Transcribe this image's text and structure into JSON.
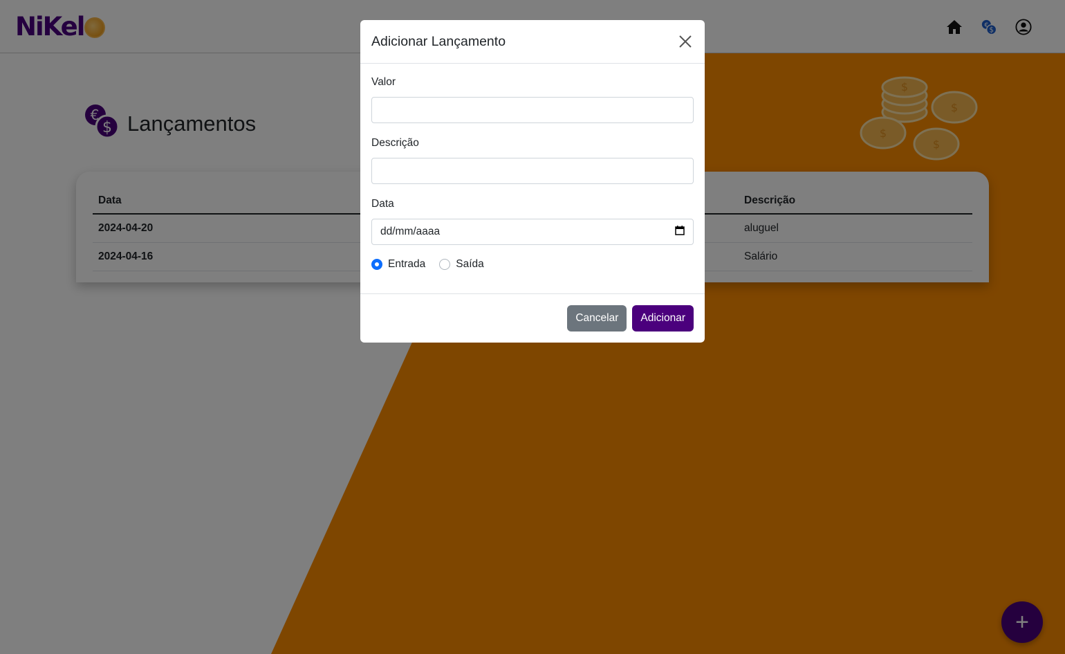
{
  "navbar": {
    "logo_text": "NiKel",
    "icons": [
      "home-icon",
      "currency-icon",
      "user-icon"
    ]
  },
  "page": {
    "title": "Lançamentos",
    "icon": "currency-icon"
  },
  "table": {
    "headers": {
      "date": "Data",
      "description": "Descrição"
    },
    "rows": [
      {
        "date": "2024-04-20",
        "description": "aluguel"
      },
      {
        "date": "2024-04-16",
        "description": "Salário"
      }
    ]
  },
  "fab": {
    "label": "+"
  },
  "modal": {
    "title": "Adicionar Lançamento",
    "fields": {
      "value_label": "Valor",
      "value": "",
      "description_label": "Descrição",
      "description": "",
      "date_label": "Data",
      "date_placeholder": "dd/mm/aaaa"
    },
    "radio": {
      "options": [
        "Entrada",
        "Saída"
      ],
      "selected": "Entrada"
    },
    "buttons": {
      "cancel": "Cancelar",
      "add": "Adicionar"
    }
  },
  "colors": {
    "brand_purple": "#4b007d",
    "orange": "#fd8c00",
    "radio_blue": "#0d6efd",
    "secondary_gray": "#6c757d"
  }
}
